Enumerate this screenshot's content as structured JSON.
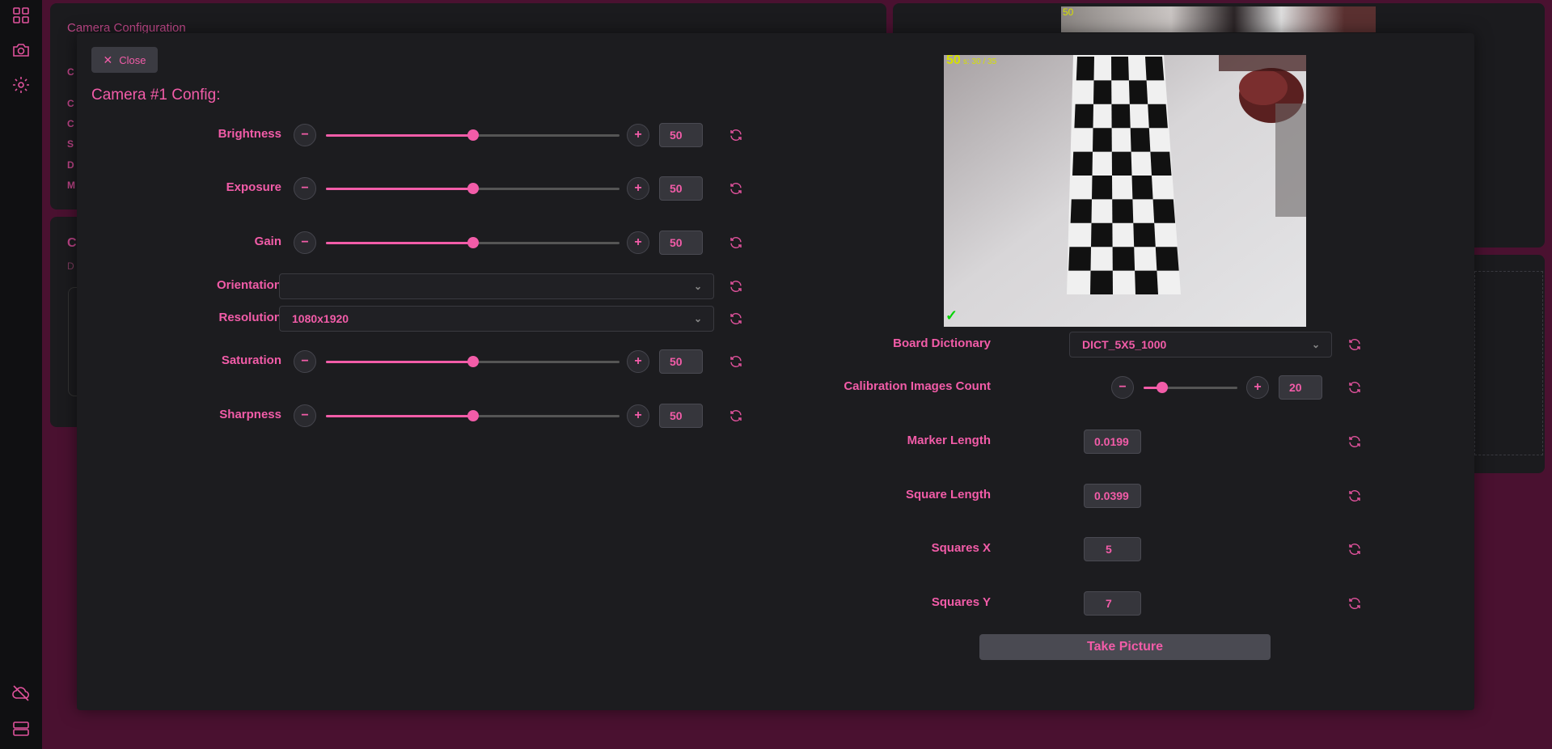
{
  "background": {
    "card_title": "Camera Configuration",
    "letters": [
      "C",
      "C",
      "C",
      "S",
      "D",
      "M"
    ],
    "card2_letter": "C",
    "card2_sub": "D",
    "preview_overlay": "50"
  },
  "dialog": {
    "close_label": "Close",
    "title": "Camera #1 Config:"
  },
  "camera_settings": {
    "brightness": {
      "label": "Brightness",
      "value": "50",
      "level": 0.5
    },
    "exposure": {
      "label": "Exposure",
      "value": "50",
      "level": 0.5
    },
    "gain": {
      "label": "Gain",
      "value": "50",
      "level": 0.5
    },
    "orientation": {
      "label": "Orientation",
      "value": ""
    },
    "resolution": {
      "label": "Resolution",
      "value": "1080x1920"
    },
    "saturation": {
      "label": "Saturation",
      "value": "50",
      "level": 0.5
    },
    "sharpness": {
      "label": "Sharpness",
      "value": "50",
      "level": 0.5
    }
  },
  "preview": {
    "overlay_text": "50",
    "overlay_sub": "s: 30 / 35",
    "check": "✓"
  },
  "calibration": {
    "board_dictionary": {
      "label": "Board Dictionary",
      "value": "DICT_5X5_1000"
    },
    "images_count": {
      "label": "Calibration Images Count",
      "value": "20",
      "level": 0.2
    },
    "marker_length": {
      "label": "Marker Length",
      "value": "0.0199"
    },
    "square_length": {
      "label": "Square Length",
      "value": "0.0399"
    },
    "squares_x": {
      "label": "Squares X",
      "value": "5"
    },
    "squares_y": {
      "label": "Squares Y",
      "value": "7"
    },
    "take_picture_label": "Take Picture"
  },
  "colors": {
    "accent": "#f25ca8",
    "dialog_bg": "#1c1c1f",
    "page_bg": "#4a1130"
  }
}
